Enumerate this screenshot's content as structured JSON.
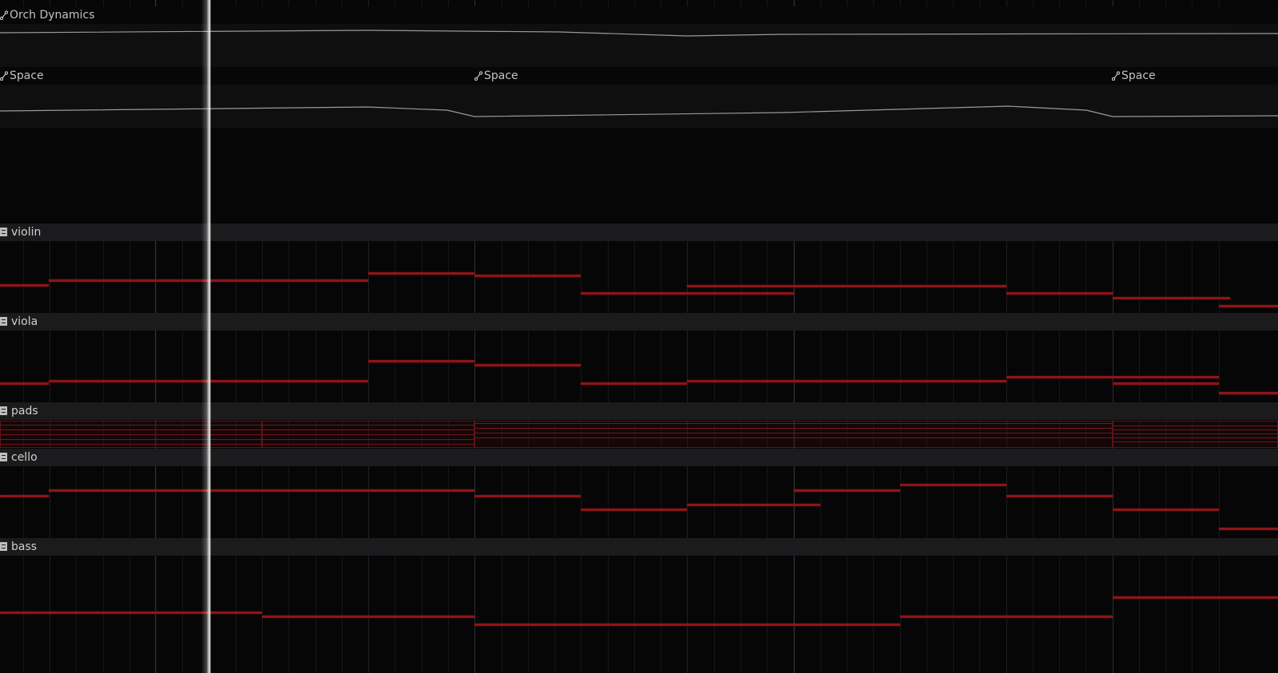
{
  "automation_lanes": [
    {
      "id": "orch",
      "labels": [
        "Orch Dynamics"
      ]
    },
    {
      "id": "space",
      "labels": [
        "Space",
        "Space",
        "Space"
      ]
    }
  ],
  "tracks": [
    {
      "id": "violin",
      "name": "violin"
    },
    {
      "id": "viola",
      "name": "viola"
    },
    {
      "id": "pads",
      "name": "pads"
    },
    {
      "id": "cello",
      "name": "cello"
    },
    {
      "id": "bass",
      "name": "bass"
    }
  ],
  "icons": {
    "automation": "automation-node-icon",
    "track": "midi-track-icon"
  },
  "colors": {
    "note": "#8f1418",
    "background": "#060607",
    "header": "#1b1b1d",
    "automation_curve": "#9a9a9a",
    "playhead": "#ffffff"
  }
}
